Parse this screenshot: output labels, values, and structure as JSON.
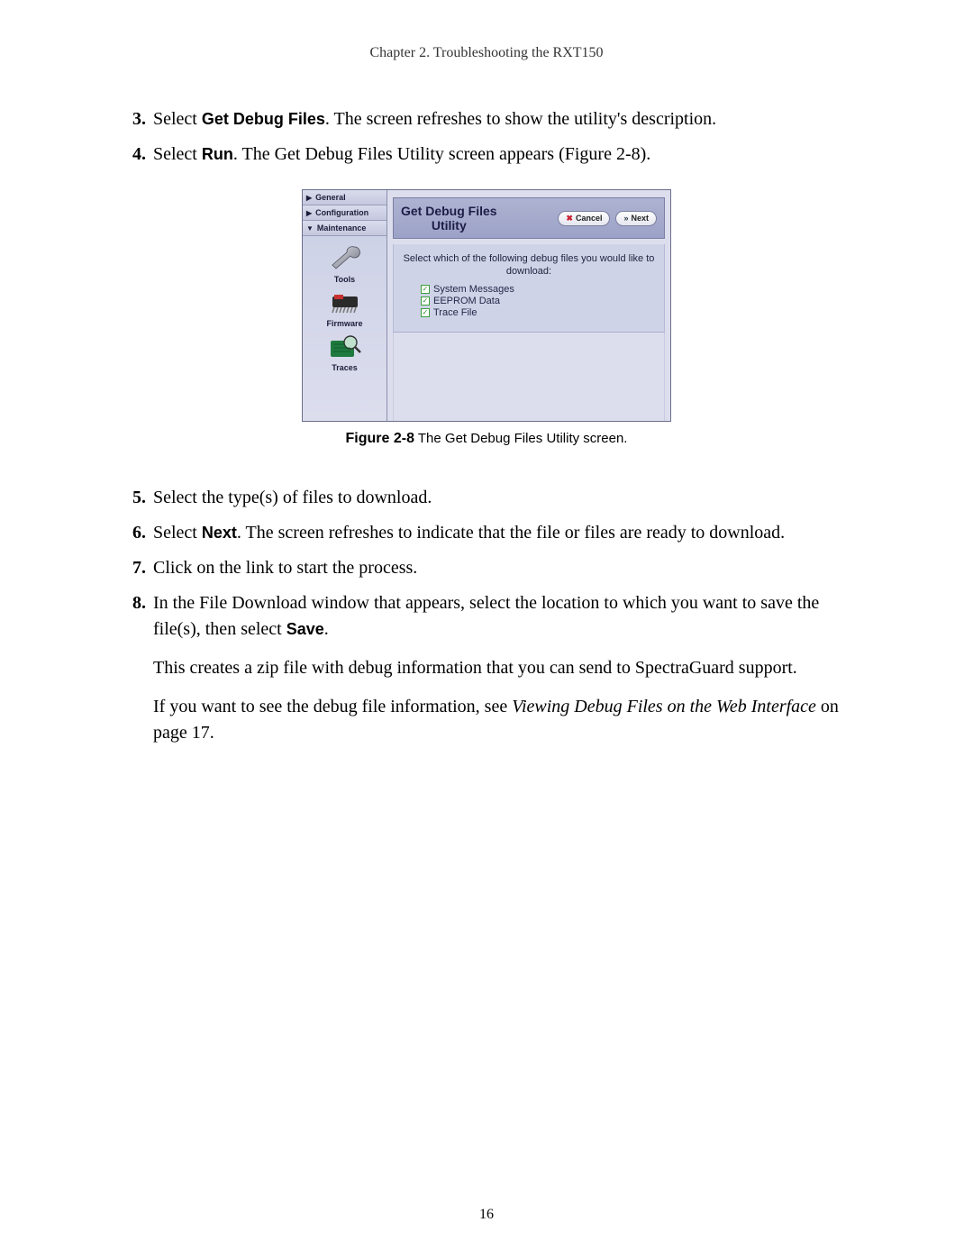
{
  "header": {
    "chapter_line": "Chapter 2.  Troubleshooting the RXT150"
  },
  "steps_a": [
    {
      "n": "3.",
      "pre": "Select ",
      "bold": "Get Debug Files",
      "post": ". The screen refreshes to show the utility's description."
    },
    {
      "n": "4.",
      "pre": "Select ",
      "bold": "Run",
      "post": ". The Get Debug Files Utility screen appears (Figure 2-8)."
    }
  ],
  "figure": {
    "caption_bold": "Figure 2-8",
    "caption_rest": "  The Get Debug Files Utility screen.",
    "sidebar": {
      "nav": [
        {
          "label": "General",
          "expanded": false
        },
        {
          "label": "Configuration",
          "expanded": false
        },
        {
          "label": "Maintenance",
          "expanded": true
        }
      ],
      "sub": [
        {
          "label": "Tools",
          "icon": "wrench-icon"
        },
        {
          "label": "Firmware",
          "icon": "chip-icon"
        },
        {
          "label": "Traces",
          "icon": "magnifier-icon"
        }
      ]
    },
    "panel": {
      "title_line1": "Get Debug Files",
      "title_line2": "Utility",
      "cancel": "Cancel",
      "next": "Next",
      "prompt": "Select which of the following debug files you would like to download:",
      "checks": [
        "System Messages",
        "EEPROM Data",
        "Trace File"
      ]
    }
  },
  "steps_b": [
    {
      "n": "5.",
      "plain": "Select the type(s) of files to download."
    },
    {
      "n": "6.",
      "pre": "Select ",
      "bold": "Next",
      "post": ". The screen refreshes to indicate that the file or files are ready to download."
    },
    {
      "n": "7.",
      "plain": "Click on the link to start the process."
    },
    {
      "n": "8.",
      "pre": "In the File Download window that appears, select the location to which you want to save the file(s), then select ",
      "bold": "Save",
      "post": "."
    }
  ],
  "follow": {
    "p1": "This creates a zip file with debug information that you can send to SpectraGuard support.",
    "p2_a": "If you want to see the debug file information, see ",
    "p2_i": "Viewing Debug Files on the Web Interface",
    "p2_b": " on page 17."
  },
  "page_number": "16"
}
